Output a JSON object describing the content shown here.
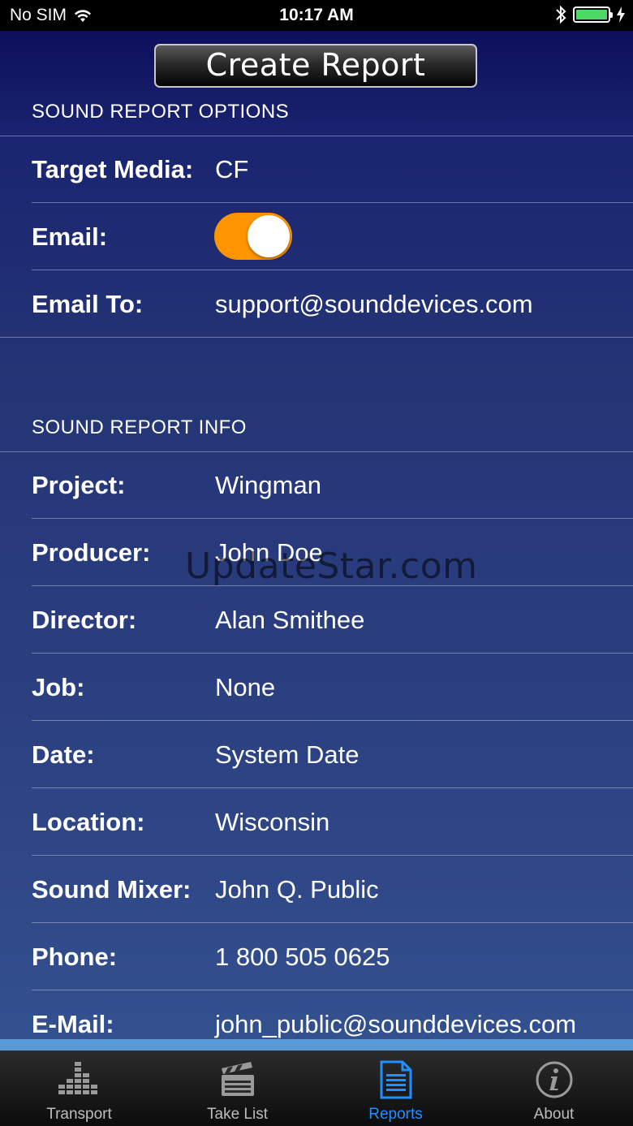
{
  "status_bar": {
    "carrier": "No SIM",
    "time": "10:17 AM",
    "battery_color": "#4cd964"
  },
  "toolbar": {
    "create_report_label": "Create Report"
  },
  "options": {
    "header": "SOUND REPORT OPTIONS",
    "target_media_label": "Target Media:",
    "target_media_value": "CF",
    "email_label": "Email:",
    "email_enabled": true,
    "email_to_label": "Email To:",
    "email_to_value": "support@sounddevices.com",
    "toggle_color": "#ff9500"
  },
  "info": {
    "header": "SOUND REPORT INFO",
    "rows": [
      {
        "label": "Project:",
        "value": "Wingman"
      },
      {
        "label": "Producer:",
        "value": "John Doe"
      },
      {
        "label": "Director:",
        "value": "Alan Smithee"
      },
      {
        "label": "Job:",
        "value": "None"
      },
      {
        "label": "Date:",
        "value": "System Date"
      },
      {
        "label": "Location:",
        "value": "Wisconsin"
      },
      {
        "label": "Sound Mixer:",
        "value": "John Q. Public"
      },
      {
        "label": "Phone:",
        "value": "1 800 505 0625"
      },
      {
        "label": "E-Mail:",
        "value": "john_public@sounddevices.com"
      }
    ]
  },
  "watermark": "UpdateStar.com",
  "tabs": [
    {
      "label": "Transport",
      "icon": "equalizer-icon",
      "active": false
    },
    {
      "label": "Take List",
      "icon": "clapperboard-icon",
      "active": false
    },
    {
      "label": "Reports",
      "icon": "document-icon",
      "active": true
    },
    {
      "label": "About",
      "icon": "info-icon",
      "active": false
    }
  ],
  "active_tab_color": "#1e90ff"
}
